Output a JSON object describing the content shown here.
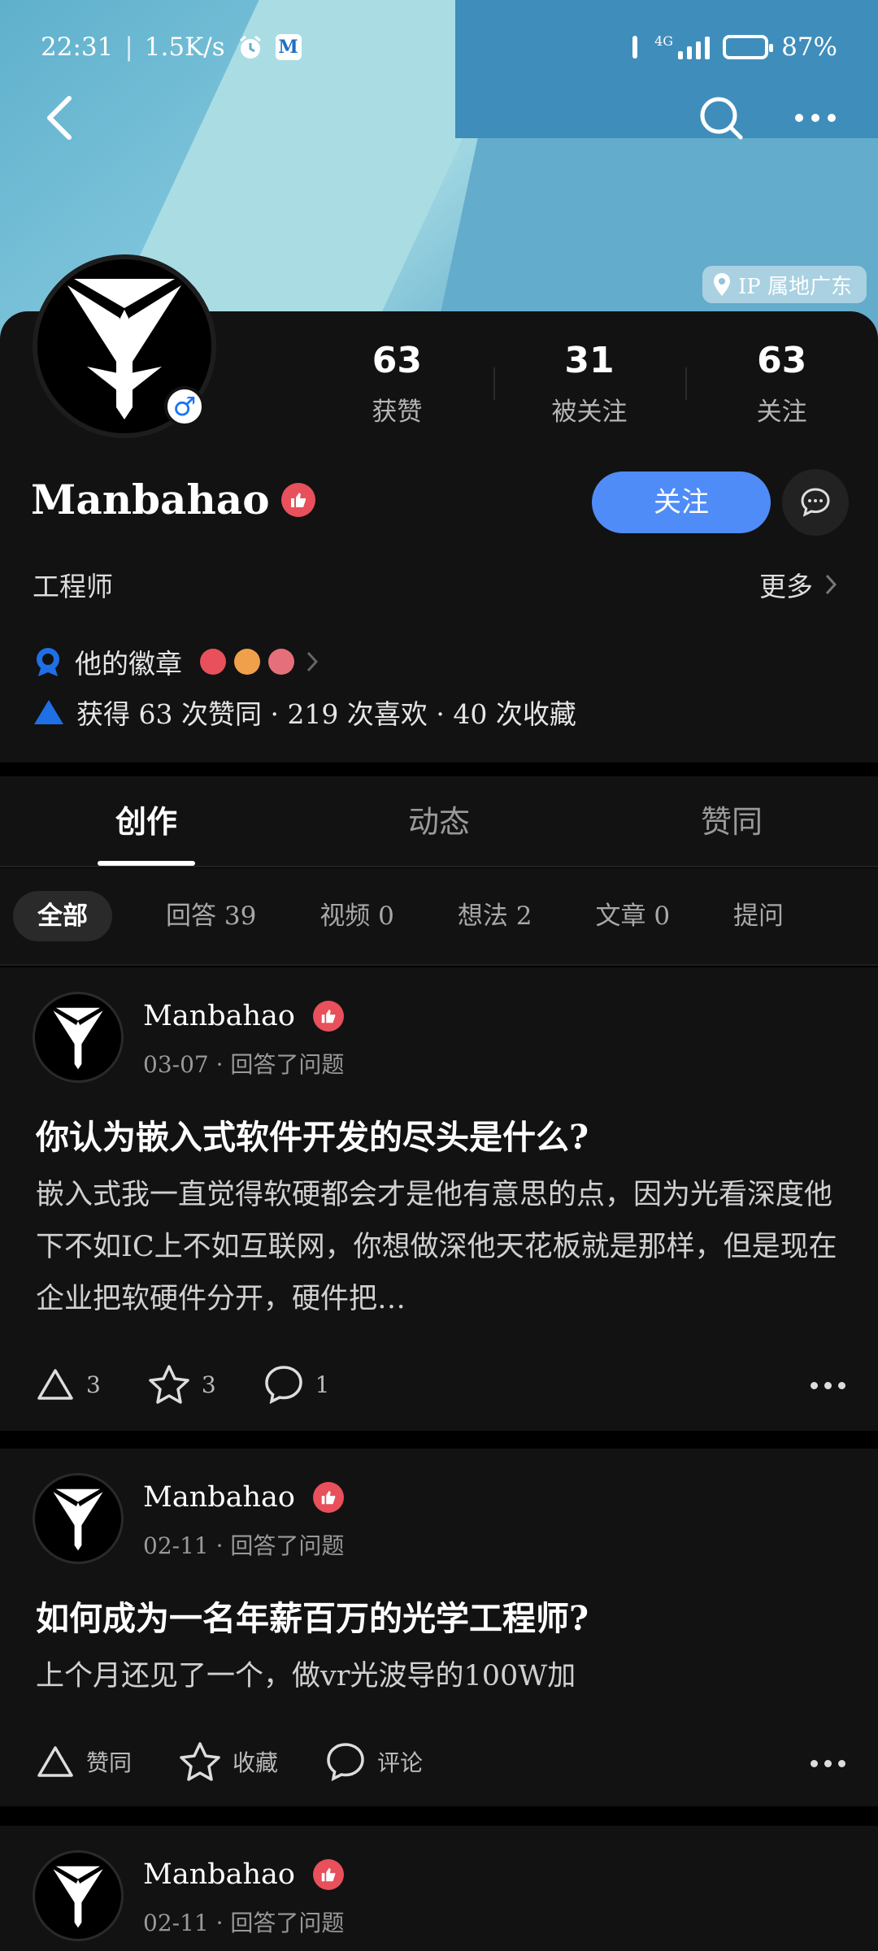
{
  "status_bar": {
    "time": "22:31",
    "net_speed": "1.5K/s",
    "network": "4G",
    "battery": "87%"
  },
  "location": {
    "label": "IP 属地广东"
  },
  "stats": [
    {
      "value": "63",
      "label": "获赞"
    },
    {
      "value": "31",
      "label": "被关注"
    },
    {
      "value": "63",
      "label": "关注"
    }
  ],
  "user": {
    "name": "Manbahao",
    "job": "工程师",
    "more": "更多",
    "follow_label": "关注"
  },
  "badges": {
    "label": "他的徽章"
  },
  "achievements": {
    "text": "获得 63 次赞同 · 219 次喜欢 · 40 次收藏"
  },
  "tabs": [
    "创作",
    "动态",
    "赞同"
  ],
  "filters": [
    "全部",
    "回答 39",
    "视频 0",
    "想法 2",
    "文章 0",
    "提问"
  ],
  "posts": [
    {
      "author": "Manbahao",
      "meta": "03-07 · 回答了问题",
      "title": "你认为嵌入式软件开发的尽头是什么?",
      "body": "嵌入式我一直觉得软硬都会才是他有意思的点，因为光看深度他下不如IC上不如互联网，你想做深他天花板就是那样，但是现在企业把软硬件分开，硬件把…",
      "vote": "3",
      "star": "3",
      "comment": "1"
    },
    {
      "author": "Manbahao",
      "meta": "02-11 · 回答了问题",
      "title": "如何成为一名年薪百万的光学工程师?",
      "body": "上个月还见了一个，做vr光波导的100W加",
      "vote": "赞同",
      "star": "收藏",
      "comment": "评论"
    },
    {
      "author": "Manbahao",
      "meta": "02-11 · 回答了问题"
    }
  ],
  "colors": {
    "accent": "#4f8cf7",
    "badge_red": "#e8505b",
    "badge_blue": "#1f6fe5"
  }
}
